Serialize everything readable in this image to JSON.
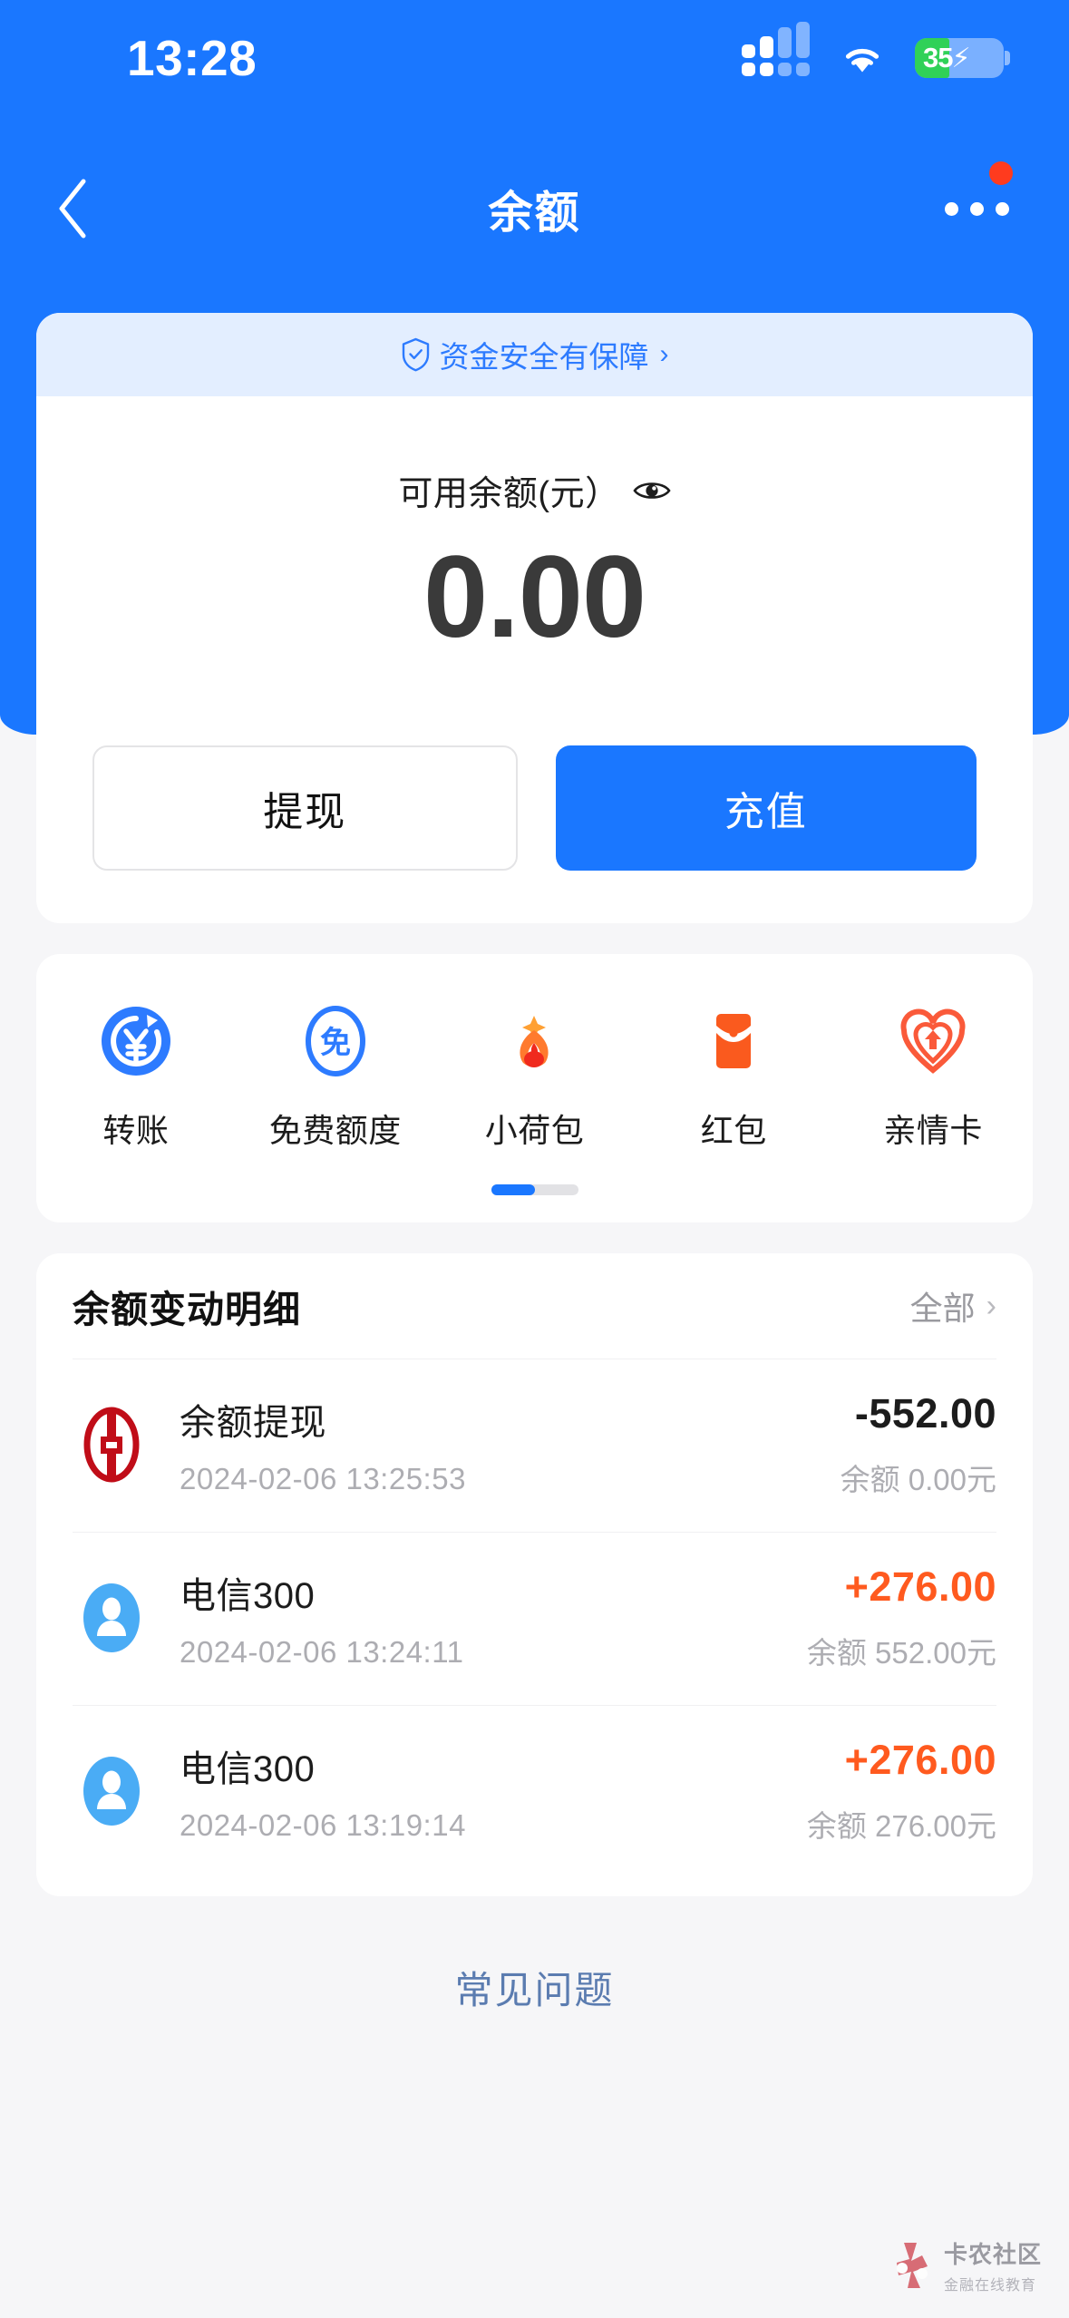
{
  "status_bar": {
    "time": "13:28",
    "battery_percent": "35",
    "battery_charging": true,
    "signal_icon": "signal-bars-icon",
    "wifi_icon": "wifi-icon"
  },
  "nav": {
    "title": "余额",
    "back_icon": "chevron-left-icon",
    "more_icon": "more-horizontal-icon",
    "has_notification_dot": true
  },
  "balance_card": {
    "safety_text": "资金安全有保障",
    "safety_chevron": "›",
    "safety_icon": "shield-check-icon",
    "label": "可用余额(元）",
    "eye_icon": "eye-icon",
    "amount": "0.00",
    "withdraw_label": "提现",
    "recharge_label": "充值"
  },
  "quick_actions": [
    {
      "label": "转账",
      "icon": "transfer-yuan-icon"
    },
    {
      "label": "免费额度",
      "icon": "free-quota-icon"
    },
    {
      "label": "小荷包",
      "icon": "small-pocket-icon"
    },
    {
      "label": "红包",
      "icon": "red-packet-icon"
    },
    {
      "label": "亲情卡",
      "icon": "family-card-icon"
    }
  ],
  "pagination": {
    "pages": 2,
    "active": 1
  },
  "transactions": {
    "title": "余额变动明细",
    "all_label": "全部",
    "all_chevron": "›",
    "rows": [
      {
        "icon": "bank-of-china-icon",
        "name": "余额提现",
        "time": "2024-02-06 13:25:53",
        "amount": "-552.00",
        "amount_sign": "negative",
        "balance_after": "余额 0.00元"
      },
      {
        "icon": "user-avatar-icon",
        "name": "电信300",
        "time": "2024-02-06 13:24:11",
        "amount": "+276.00",
        "amount_sign": "positive",
        "balance_after": "余额 552.00元"
      },
      {
        "icon": "user-avatar-icon",
        "name": "电信300",
        "time": "2024-02-06 13:19:14",
        "amount": "+276.00",
        "amount_sign": "positive",
        "balance_after": "余额 276.00元"
      }
    ]
  },
  "footer": {
    "faq_label": "常见问题"
  },
  "watermark": {
    "line1": "卡农社区",
    "line2": "金融在线教育"
  },
  "colors": {
    "brand_blue": "#1a77ff",
    "safety_bg": "#e3eeff",
    "positive_orange": "#ff5a1f",
    "page_bg": "#f6f6f8",
    "muted_text": "#adadb2"
  }
}
